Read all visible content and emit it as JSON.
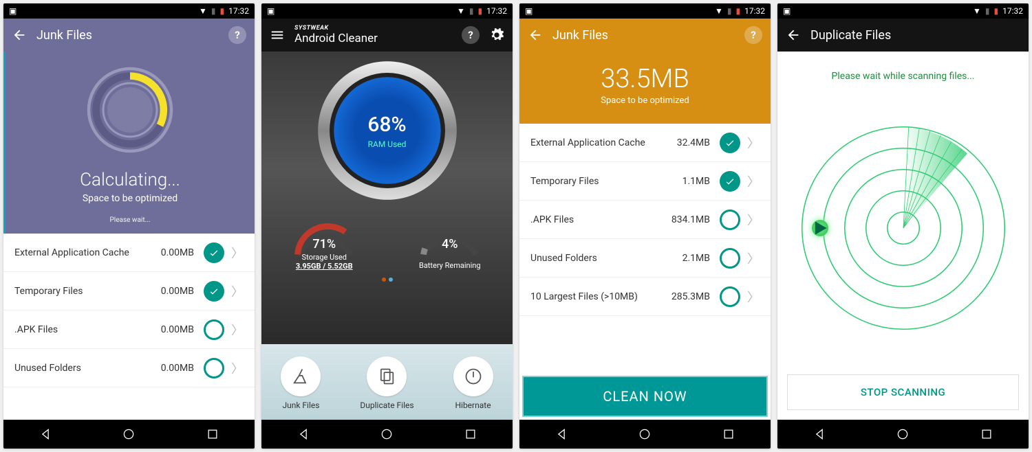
{
  "status": {
    "time": "17:32"
  },
  "p1": {
    "title": "Junk Files",
    "calculating": "Calculating...",
    "subtitle": "Space to be optimized",
    "wait": "Please wait...",
    "rows": [
      {
        "label": "External Application Cache",
        "size": "0.00MB",
        "checked": true
      },
      {
        "label": "Temporary Files",
        "size": "0.00MB",
        "checked": true
      },
      {
        "label": ".APK Files",
        "size": "0.00MB",
        "checked": false
      },
      {
        "label": "Unused Folders",
        "size": "0.00MB",
        "checked": false
      }
    ]
  },
  "p2": {
    "brand": "SYSTWEAK",
    "title": "Android Cleaner",
    "ram_pct": "68%",
    "ram_label": "RAM Used",
    "storage_pct": "71%",
    "storage_label": "Storage Used",
    "storage_stats": "3.95GB / 5.52GB",
    "battery_pct": "4%",
    "battery_label": "Battery Remaining",
    "actions": [
      {
        "label": "Junk Files",
        "icon": "broom-icon"
      },
      {
        "label": "Duplicate Files",
        "icon": "copy-icon"
      },
      {
        "label": "Hibernate",
        "icon": "power-icon"
      }
    ]
  },
  "p3": {
    "title": "Junk Files",
    "big_size": "33.5MB",
    "subtitle": "Space to be optimized",
    "rows": [
      {
        "label": "External Application Cache",
        "size": "32.4MB",
        "checked": true
      },
      {
        "label": "Temporary Files",
        "size": "1.1MB",
        "checked": true
      },
      {
        "label": ".APK Files",
        "size": "834.1MB",
        "checked": false
      },
      {
        "label": "Unused Folders",
        "size": "2.1MB",
        "checked": false
      },
      {
        "label": "10 Largest Files (>10MB)",
        "size": "285.3MB",
        "checked": false
      }
    ],
    "button": "CLEAN NOW"
  },
  "p4": {
    "title": "Duplicate Files",
    "message": "Please wait while scanning files...",
    "button": "STOP SCANNING"
  }
}
